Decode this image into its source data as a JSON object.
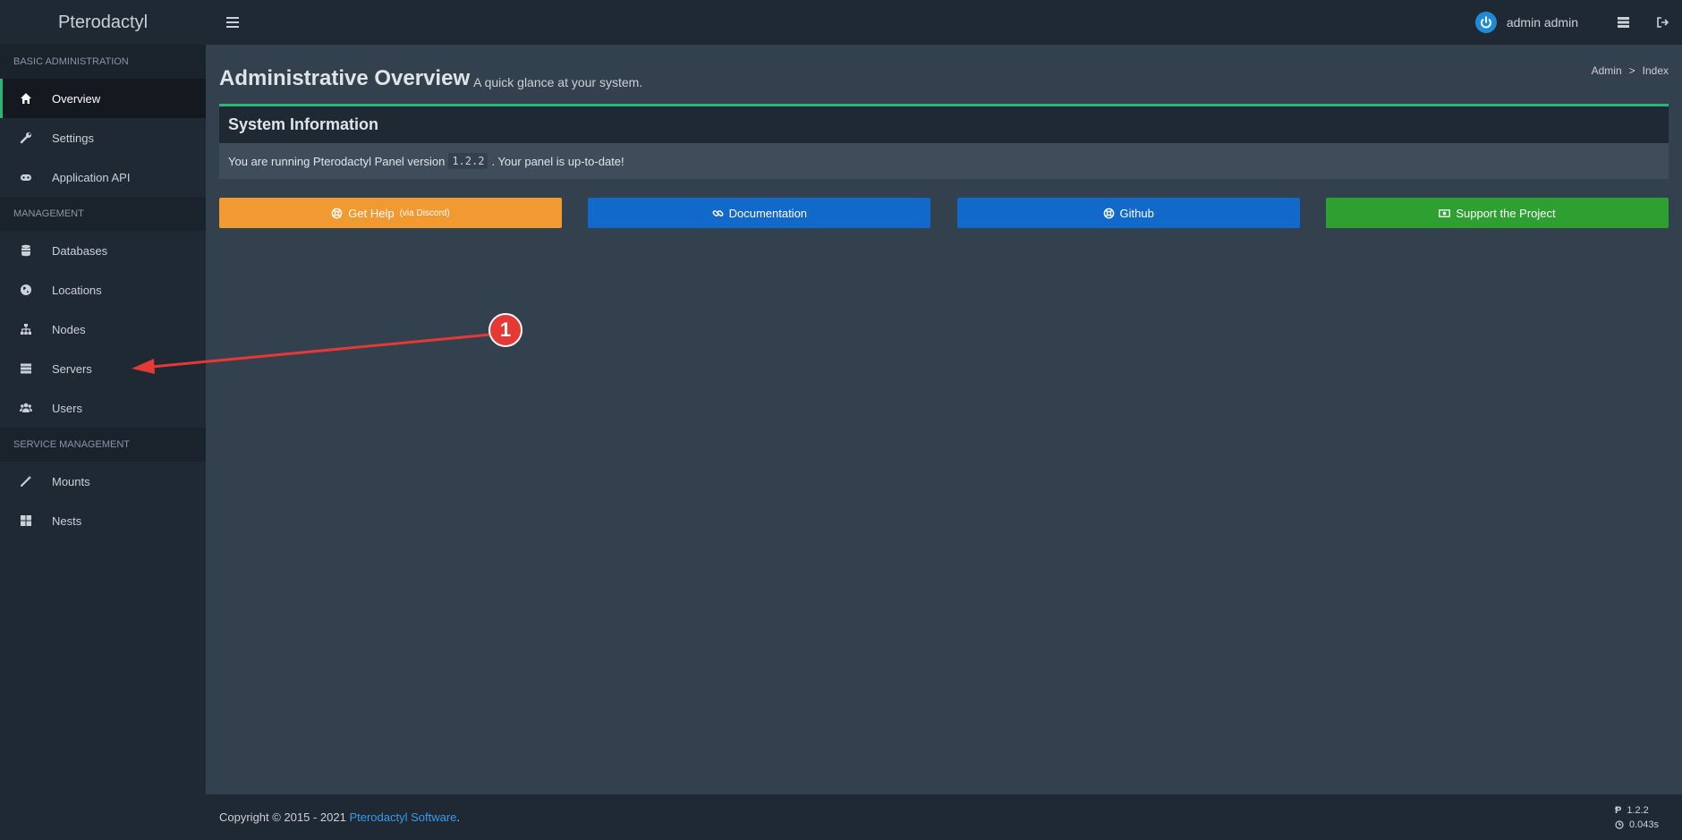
{
  "brand": {
    "name": "Pterodactyl"
  },
  "header": {
    "user_name": "admin admin"
  },
  "sidebar": {
    "sections": [
      {
        "title": "BASIC ADMINISTRATION",
        "items": [
          "Overview",
          "Settings",
          "Application API"
        ]
      },
      {
        "title": "MANAGEMENT",
        "items": [
          "Databases",
          "Locations",
          "Nodes",
          "Servers",
          "Users"
        ]
      },
      {
        "title": "SERVICE MANAGEMENT",
        "items": [
          "Mounts",
          "Nests"
        ]
      }
    ],
    "active_item": "Overview"
  },
  "page": {
    "title": "Administrative Overview",
    "subtitle": "A quick glance at your system.",
    "breadcrumb": {
      "admin": "Admin",
      "separator": ">",
      "current": "Index"
    }
  },
  "system_info": {
    "title": "System Information",
    "text_before": "You are running Pterodactyl Panel version",
    "version": "1.2.2",
    "text_after": ". Your panel is up-to-date!"
  },
  "buttons": {
    "help": {
      "label": "Get Help",
      "suffix": "(via Discord)",
      "color": "#f29a32"
    },
    "docs": {
      "label": "Documentation",
      "color": "#1169c9"
    },
    "github": {
      "label": "Github",
      "color": "#1169c9"
    },
    "support": {
      "label": "Support the Project",
      "color": "#2ea032"
    }
  },
  "annotation": {
    "badge": "1",
    "color": "#e53935"
  },
  "footer": {
    "copyright": "Copyright © 2015 - 2021",
    "link": "Pterodactyl Software",
    "period": ".",
    "version": "1.2.2",
    "time": "0.043s"
  },
  "colors": {
    "accent": "#2bb673",
    "background": "#33404d",
    "sidebar": "#1f2933"
  }
}
